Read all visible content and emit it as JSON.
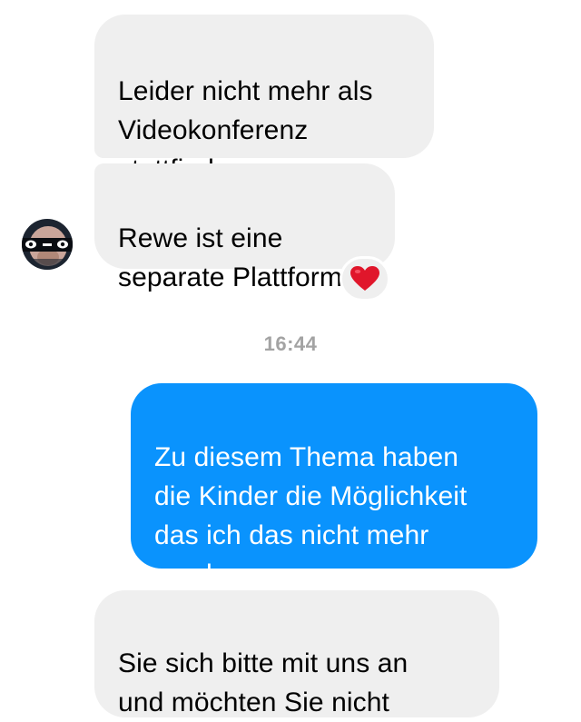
{
  "messages": {
    "incoming_1": "Leider nicht mehr als\nVideokonferenz\nstattfinden",
    "incoming_2": "Rewe ist eine\nseparate Plattform",
    "reaction": "heart",
    "timestamp": "16:44",
    "outgoing_1": "Zu diesem Thema haben\ndie Kinder die Möglichkeit\ndas ich das nicht mehr\nmachen muss",
    "incoming_3": "Sie sich bitte mit uns an\nund möchten Sie nicht"
  },
  "icons": {
    "avatar": "contact-avatar",
    "reaction": "heart-icon"
  },
  "colors": {
    "incoming_bubble": "#efefef",
    "outgoing_bubble": "#0a93fd",
    "timestamp": "#a3a3a3",
    "heart": "#e0162b"
  }
}
